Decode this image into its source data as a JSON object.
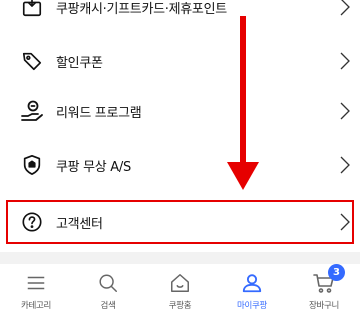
{
  "menu": {
    "items": [
      {
        "label": "쿠팡캐시·기프트카드·제휴포인트",
        "icon": "gift-card-icon"
      },
      {
        "label": "할인쿠폰",
        "icon": "coupon-tag-icon"
      },
      {
        "label": "리워드 프로그램",
        "icon": "reward-hand-coin-icon"
      },
      {
        "label": "쿠팡 무상 A/S",
        "icon": "shield-service-icon"
      },
      {
        "label": "고객센터",
        "icon": "question-circle-icon"
      }
    ]
  },
  "tabbar": {
    "tabs": [
      {
        "label": "카테고리",
        "icon": "hamburger-menu-icon",
        "active": false
      },
      {
        "label": "검색",
        "icon": "search-icon",
        "active": false
      },
      {
        "label": "쿠팡홈",
        "icon": "home-icon",
        "active": false
      },
      {
        "label": "마이쿠팡",
        "icon": "user-icon",
        "active": true
      },
      {
        "label": "장바구니",
        "icon": "cart-icon",
        "active": false,
        "badge": "3"
      }
    ]
  },
  "colors": {
    "accent": "#346aff",
    "annotation": "#e60000",
    "separator": "#f2f2f2"
  }
}
